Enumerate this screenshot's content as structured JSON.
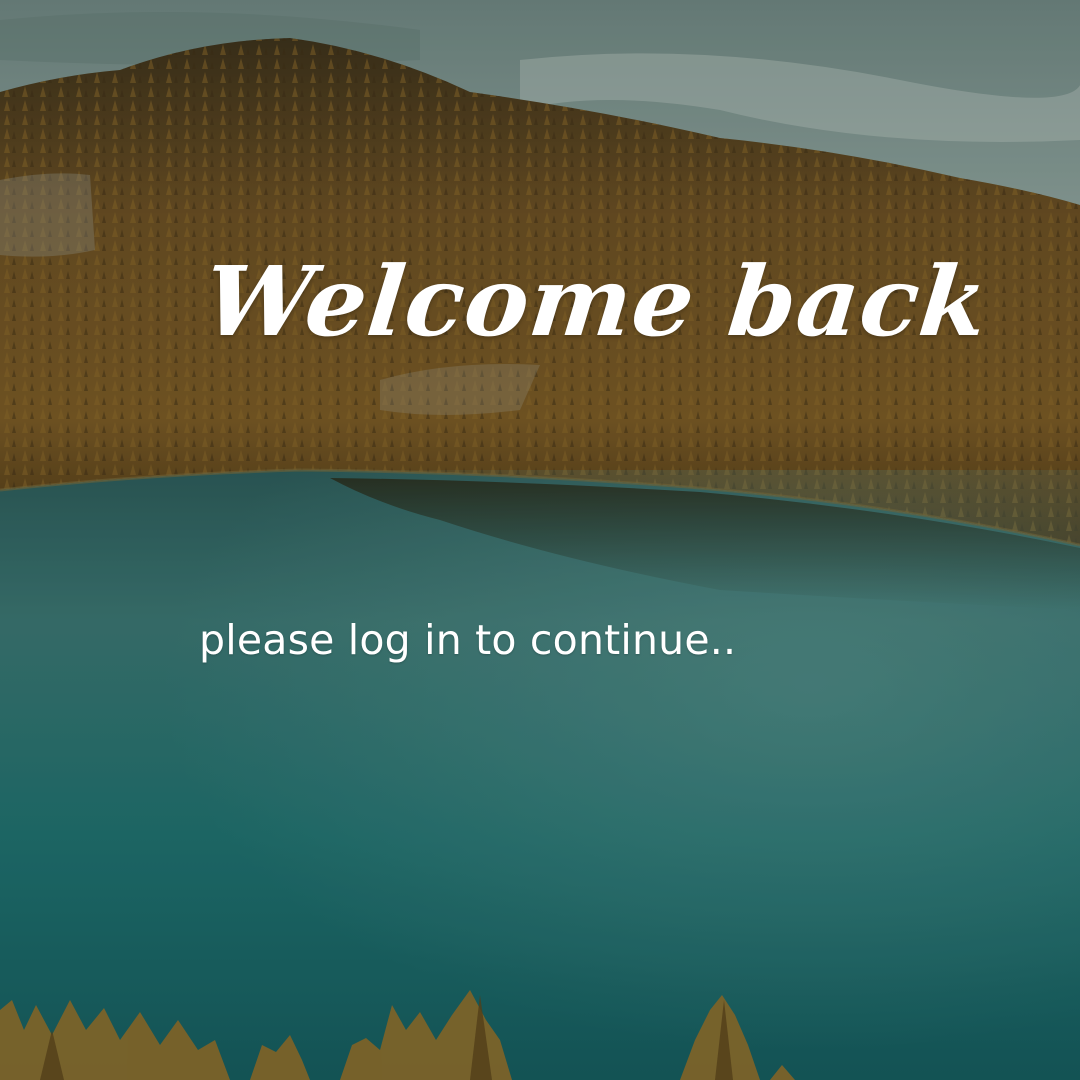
{
  "screen": {
    "heading": "Welcome back",
    "subheading": "please log in to continue..",
    "background_image": "landscape-lake-forest-hill-image"
  },
  "colors": {
    "text": "#ffffff",
    "sky": "#8fa39b",
    "forest": "#6a4a1c",
    "lake": "#1f6b6a"
  }
}
